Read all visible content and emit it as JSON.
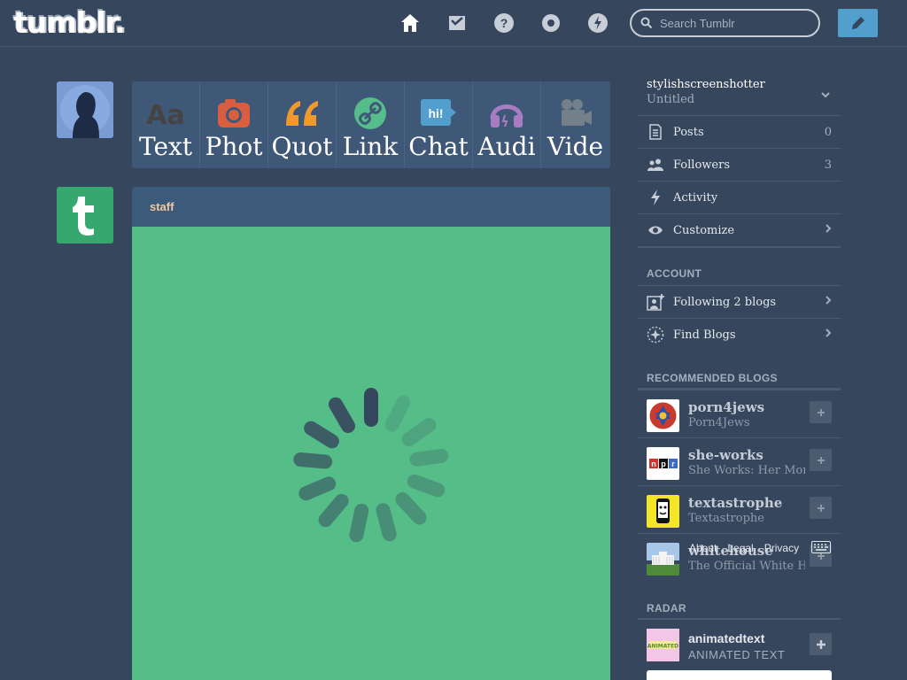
{
  "header": {
    "logo": "tumblr.",
    "nav_icons": [
      "home-icon",
      "inbox-icon",
      "help-icon",
      "settings-icon",
      "activity-icon"
    ],
    "search_placeholder": "Search Tumblr",
    "compose_icon": "pencil-icon"
  },
  "post_types": [
    {
      "label": "Text",
      "icon": "text-icon",
      "color": "#444444"
    },
    {
      "label": "Phot",
      "icon": "camera-icon",
      "color": "#d95e40"
    },
    {
      "label": "Quot",
      "icon": "quote-icon",
      "color": "#f2992e"
    },
    {
      "label": "Link",
      "icon": "link-icon",
      "color": "#56bc8a"
    },
    {
      "label": "Chat",
      "icon": "chat-icon",
      "color": "#529ecc"
    },
    {
      "label": "Audi",
      "icon": "headphones-icon",
      "color": "#a77dc2"
    },
    {
      "label": "Vide",
      "icon": "video-camera-icon",
      "color": "#748089"
    }
  ],
  "post": {
    "author": "staff",
    "body_color": "#55bd88",
    "loading": true
  },
  "sidebar": {
    "blog_name": "stylishscreenshotter",
    "blog_title": "Untitled",
    "items": [
      {
        "label": "Posts",
        "count": "0",
        "icon": "posts-icon"
      },
      {
        "label": "Followers",
        "count": "3",
        "icon": "followers-icon"
      },
      {
        "label": "Activity",
        "count": "",
        "icon": "lightning-icon"
      },
      {
        "label": "Customize",
        "count": "",
        "icon": "eye-icon"
      }
    ],
    "account_title": "ACCOUNT",
    "account_items": [
      {
        "label": "Following 2 blogs",
        "icon": "add-user-icon"
      },
      {
        "label": "Find Blogs",
        "icon": "compass-icon"
      }
    ],
    "recommended_title": "RECOMMENDED BLOGS",
    "recommended": [
      {
        "name": "porn4jews",
        "desc": "Porn4Jews"
      },
      {
        "name": "she-works",
        "desc": "She Works: Her Money"
      },
      {
        "name": "textastrophe",
        "desc": "Textastrophe"
      },
      {
        "name": "whitehouse",
        "desc": "The Official White House"
      }
    ],
    "footer_links": [
      "About",
      "Legal",
      "Privacy"
    ],
    "radar_title": "RADAR",
    "radar": {
      "name": "animatedtext",
      "desc": "ANIMATED TEXT"
    }
  }
}
